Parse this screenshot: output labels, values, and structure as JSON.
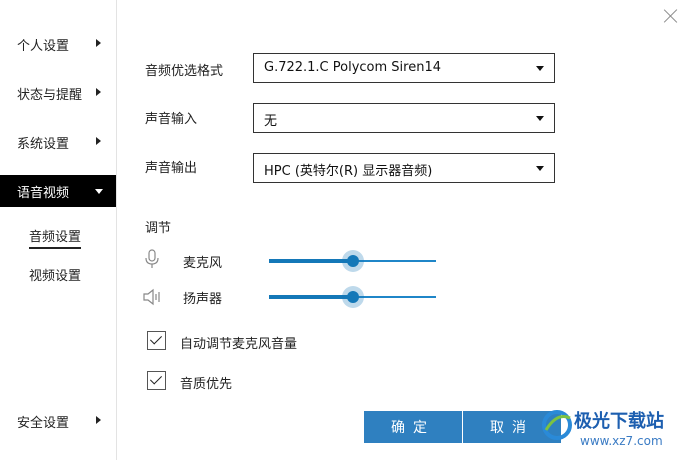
{
  "sidebar": {
    "items": [
      {
        "label": "个人设置"
      },
      {
        "label": "状态与提醒"
      },
      {
        "label": "系统设置"
      },
      {
        "label": "语音视频"
      },
      {
        "label": "安全设置"
      }
    ],
    "sub_items": [
      {
        "label": "音频设置"
      },
      {
        "label": "视频设置"
      }
    ]
  },
  "audio": {
    "codec_label": "音频优选格式",
    "codec_value": "G.722.1.C Polycom Siren14",
    "input_label": "声音输入",
    "input_value": "无",
    "output_label": "声音输出",
    "output_value": "HPC (英特尔(R) 显示器音频)"
  },
  "adjust": {
    "title": "调节",
    "mic_label": "麦克风",
    "mic_level": 0.5,
    "speaker_label": "扬声器",
    "speaker_level": 0.5
  },
  "options": {
    "auto_mic_label": "自动调节麦克风音量",
    "auto_mic_checked": true,
    "quality_label": "音质优先",
    "quality_checked": true
  },
  "buttons": {
    "ok": "确定",
    "cancel": "取消"
  },
  "watermark": {
    "title": "极光下载站",
    "url": "www.xz7.com"
  },
  "colors": {
    "accent": "#1478b8",
    "button": "#2f80c0",
    "active_nav": "#000000"
  }
}
